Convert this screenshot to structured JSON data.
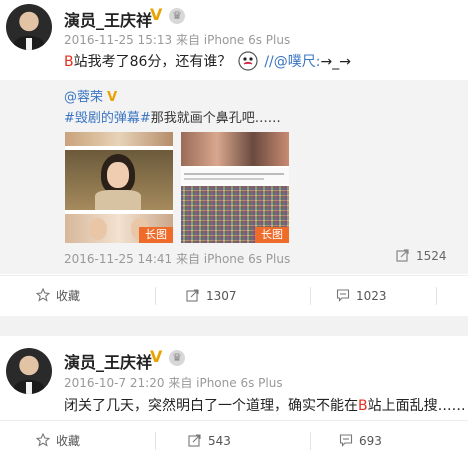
{
  "posts": [
    {
      "author": "演员_王庆祥",
      "meta": "2016-11-25 15:13 来自 iPhone 6s Plus",
      "text_red": "B",
      "text_main": "站我考了86分，还有谁？",
      "text_link": "//@噗尺:",
      "text_tail": "→_→",
      "quote": {
        "author": "@蓉荣",
        "hashtag": "#毁剧的弹幕#",
        "text": "那我就画个鼻孔吧……",
        "image_tag_1": "长图",
        "image_tag_2": "长图",
        "meta": "2016-11-25 14:41 来自 iPhone 6s Plus",
        "share_count": "1524"
      },
      "actions": {
        "favorite": "收藏",
        "share": "1307",
        "comment": "1023"
      }
    },
    {
      "author": "演员_王庆祥",
      "meta": "2016-10-7 21:20 来自 iPhone 6s Plus",
      "text_before": "闭关了几天，突然明白了一个道理，确实不能在",
      "text_red": "B",
      "text_after": "站上面乱搜……",
      "actions": {
        "favorite": "收藏",
        "share": "543",
        "comment": "693"
      }
    }
  ],
  "colors": {
    "brand_red": "#e03020",
    "link_blue": "#3a75c4",
    "badge_gold": "#e8a300",
    "tag_orange": "#ee6b2a"
  }
}
